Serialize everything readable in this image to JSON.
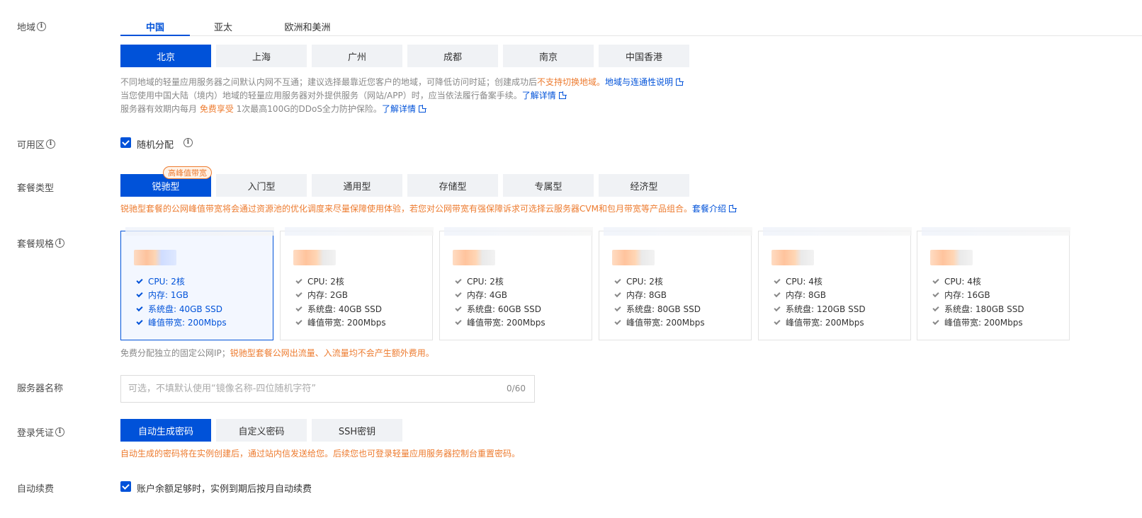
{
  "labels": {
    "region": "地域",
    "zone": "可用区",
    "plan_type": "套餐类型",
    "plan_spec": "套餐规格",
    "server_name": "服务器名称",
    "login": "登录凭证",
    "auto_renew": "自动续费"
  },
  "region_tabs": [
    "中国",
    "亚太",
    "欧洲和美洲"
  ],
  "cities": [
    "北京",
    "上海",
    "广州",
    "成都",
    "南京",
    "中国香港"
  ],
  "region_hints": {
    "line1_a": "不同地域的轻量应用服务器之间默认内网不互通；建议选择最靠近您客户的地域，可降低访问时延；创建成功后",
    "line1_orange": "不支持切换地域",
    "line1_b": "。",
    "line1_link": "地域与连通性说明",
    "line2_a": "当您使用中国大陆（境内）地域的轻量应用服务器对外提供服务（网站/APP）时，应当依法履行备案手续。",
    "line2_link": "了解详情",
    "line3_a": "服务器有效期内每月 ",
    "line3_orange": "免费享受",
    "line3_b": " 1次最高100G的DDoS全力防护保险。",
    "line3_link": "了解详情"
  },
  "zone_option": "随机分配",
  "plan_types": [
    "锐驰型",
    "入门型",
    "通用型",
    "存储型",
    "专属型",
    "经济型"
  ],
  "plan_badge": "高峰值带宽",
  "plan_hint": {
    "text": "锐驰型套餐的公网峰值带宽将会通过资源池的优化调度来尽量保障使用体验，若您对公网带宽有强保障诉求可选择云服务器CVM和包月带宽等产品组合。",
    "link": "套餐介绍"
  },
  "specs": [
    {
      "cpu": "CPU: 2核",
      "mem": "内存: 1GB",
      "disk": "系统盘: 40GB SSD",
      "bw": "峰值带宽: 200Mbps"
    },
    {
      "cpu": "CPU: 2核",
      "mem": "内存: 2GB",
      "disk": "系统盘: 40GB SSD",
      "bw": "峰值带宽: 200Mbps"
    },
    {
      "cpu": "CPU: 2核",
      "mem": "内存: 4GB",
      "disk": "系统盘: 60GB SSD",
      "bw": "峰值带宽: 200Mbps"
    },
    {
      "cpu": "CPU: 2核",
      "mem": "内存: 8GB",
      "disk": "系统盘: 80GB SSD",
      "bw": "峰值带宽: 200Mbps"
    },
    {
      "cpu": "CPU: 4核",
      "mem": "内存: 8GB",
      "disk": "系统盘: 120GB SSD",
      "bw": "峰值带宽: 200Mbps"
    },
    {
      "cpu": "CPU: 4核",
      "mem": "内存: 16GB",
      "disk": "系统盘: 180GB SSD",
      "bw": "峰值带宽: 200Mbps"
    }
  ],
  "spec_hint": {
    "a": "免费分配独立的固定公网IP；",
    "orange": "锐驰型套餐公网出流量、入流量均不会产生额外费用。"
  },
  "server_name": {
    "placeholder": "可选，不填默认使用“镜像名称-四位随机字符”",
    "counter": "0/60"
  },
  "login_options": [
    "自动生成密码",
    "自定义密码",
    "SSH密钥"
  ],
  "login_hint": "自动生成的密码将在实例创建后，通过站内信发送给您。后续您也可登录轻量应用服务器控制台重置密码。",
  "auto_renew_option": "账户余额足够时，实例到期后按月自动续费",
  "colors": {
    "primary": "#0052d9",
    "warning": "#ed7b2f"
  }
}
